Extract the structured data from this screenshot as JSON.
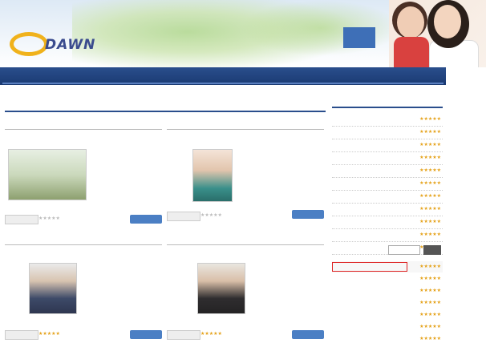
{
  "header": {
    "logo_text": "DAWN",
    "badge": "",
    "slogan": ""
  },
  "nav": {
    "items": [
      {
        "label": ""
      },
      {
        "label": ""
      }
    ]
  },
  "main": {
    "title": "",
    "sections": [
      {
        "heading": "",
        "subtitle": "",
        "caption": "",
        "desc": "",
        "cat_label": "",
        "more_label": "",
        "rating": 0
      },
      {
        "heading": "",
        "subtitle": "",
        "caption": "",
        "desc": "",
        "cat_label": "",
        "more_label": "",
        "rating": 0
      },
      {
        "heading": "",
        "subtitle": "",
        "caption": "",
        "desc": "",
        "cat_label": "",
        "more_label": "",
        "rating": 5
      },
      {
        "heading": "",
        "subtitle": "",
        "caption": "",
        "desc": "",
        "cat_label": "",
        "more_label": "",
        "rating": 5
      }
    ]
  },
  "sidebar": {
    "heading": "",
    "items": [
      {
        "title": "",
        "stars": "★★★★★"
      },
      {
        "title": "",
        "stars": "★★★★★"
      },
      {
        "title": "",
        "stars": "★★★★★"
      },
      {
        "title": "",
        "stars": "★★★★★"
      },
      {
        "title": "",
        "stars": "★★★★★"
      },
      {
        "title": "",
        "stars": "★★★★★"
      },
      {
        "title": "",
        "stars": "★★★★★"
      },
      {
        "title": "",
        "stars": "★★★★★"
      },
      {
        "title": "",
        "stars": "★★★★★"
      },
      {
        "title": "",
        "stars": "★★★★★"
      },
      {
        "title": "",
        "stars": "★★★★★"
      }
    ]
  },
  "ranking": {
    "heading": "",
    "search_placeholder": "",
    "search_button": "",
    "items": [
      {
        "title": "",
        "stars": "★★★★★"
      },
      {
        "title": "",
        "stars": "★★★★★"
      },
      {
        "title": "",
        "stars": "★★★★★"
      },
      {
        "title": "",
        "stars": "★★★★★"
      },
      {
        "title": "",
        "stars": "★★★★★"
      },
      {
        "title": "",
        "stars": "★★★★★"
      },
      {
        "title": "",
        "stars": "★★★★★"
      }
    ]
  },
  "watermark": "",
  "bottom_heading": "",
  "colors": {
    "nav": "#1a3a72",
    "accent": "#2a4e8c",
    "star": "#e5a21a",
    "button": "#4b7fc4"
  }
}
